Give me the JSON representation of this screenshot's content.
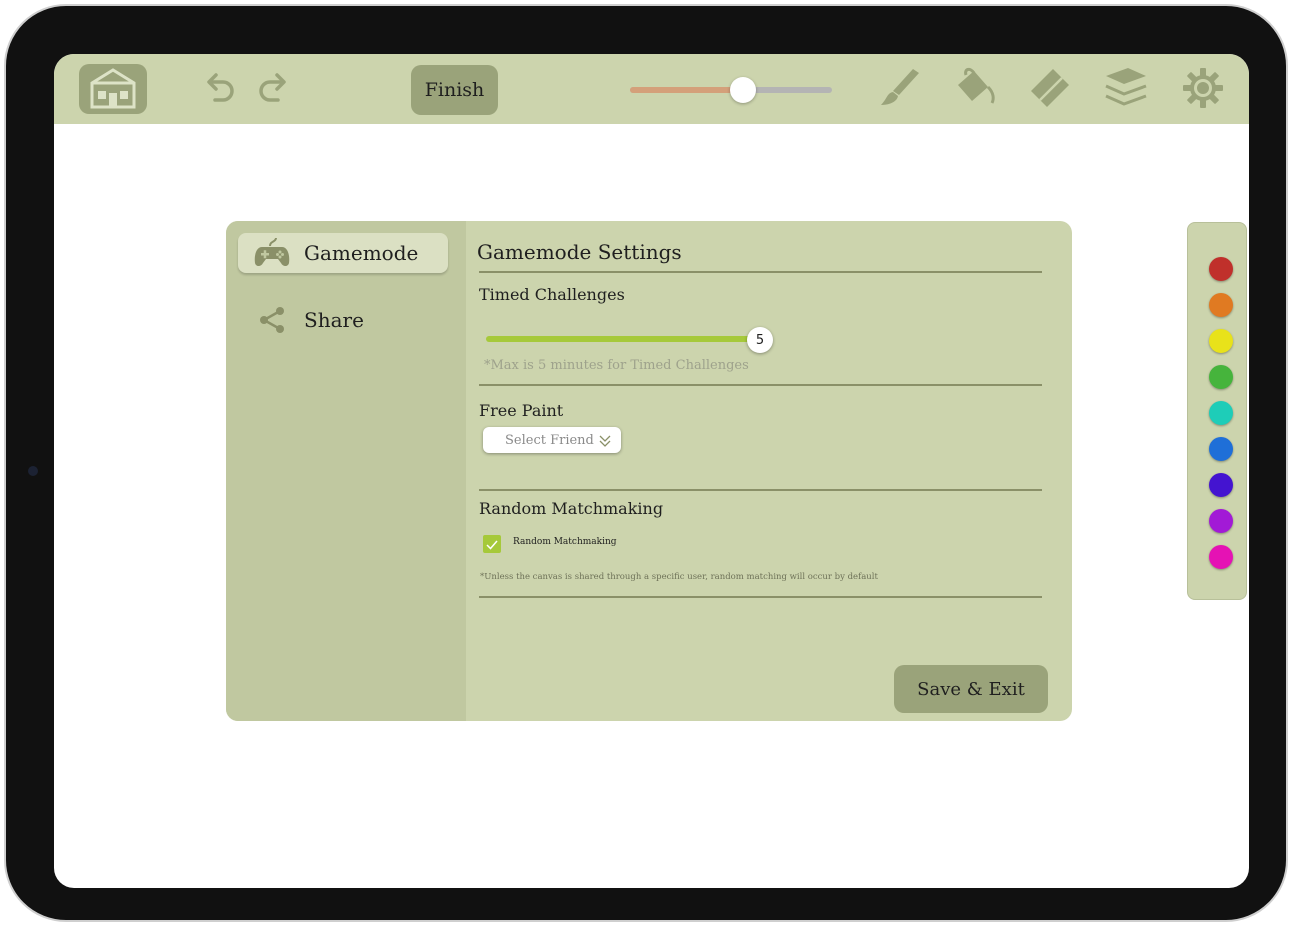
{
  "toolbar": {
    "finish_label": "Finish",
    "brush_size_fraction": 0.56
  },
  "sidebar": {
    "items": [
      {
        "label": "Gamemode",
        "active": true,
        "icon": "gamepad-icon"
      },
      {
        "label": "Share",
        "active": false,
        "icon": "share-icon"
      }
    ]
  },
  "settings": {
    "title": "Gamemode Settings",
    "timed": {
      "title": "Timed Challenges",
      "value": "5",
      "note": "*Max is 5 minutes for Timed Challenges"
    },
    "free_paint": {
      "title": "Free Paint",
      "select_placeholder": "Select Friend"
    },
    "random": {
      "title": "Random Matchmaking",
      "checkbox_label": "Random Matchmaking",
      "checked": true,
      "note": "*Unless the canvas is shared through a specific user, random matching will occur by default"
    },
    "save_label": "Save & Exit"
  },
  "palette": {
    "colors": [
      "#c0302b",
      "#e07a22",
      "#e8e21a",
      "#46b43c",
      "#1ecdb8",
      "#1f6fd8",
      "#4414d0",
      "#a21ad6",
      "#e512b4"
    ]
  },
  "colors": {
    "toolbar_bg": "#ccd4ad",
    "button_bg": "#9aa37a",
    "accent_green": "#a6c93a"
  }
}
